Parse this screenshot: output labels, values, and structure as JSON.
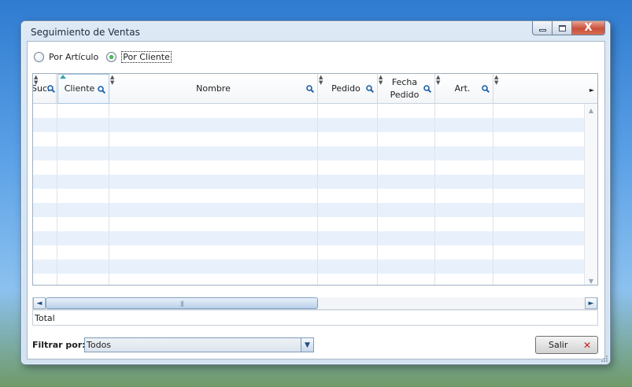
{
  "window": {
    "title": "Seguimiento de Ventas"
  },
  "caption": {
    "close_glyph": "X"
  },
  "mode": {
    "options": [
      {
        "label": "Por Artículo",
        "checked": false
      },
      {
        "label": "Por Cliente",
        "checked": true
      }
    ]
  },
  "grid": {
    "columns": [
      {
        "label": "Suc."
      },
      {
        "label": "Cliente"
      },
      {
        "label": "Nombre"
      },
      {
        "label": "Pedido"
      },
      {
        "label": "Fecha\nPedido"
      },
      {
        "label": "Art."
      }
    ],
    "rows": []
  },
  "footer": {
    "total_label": "Total"
  },
  "filter": {
    "label": "Filtrar por:",
    "value": "Todos"
  },
  "exit": {
    "label": "Salir"
  },
  "colors": {
    "row_alt": "#e8f1fb",
    "accent": "#1d4c84",
    "close_red": "#c9503a"
  }
}
